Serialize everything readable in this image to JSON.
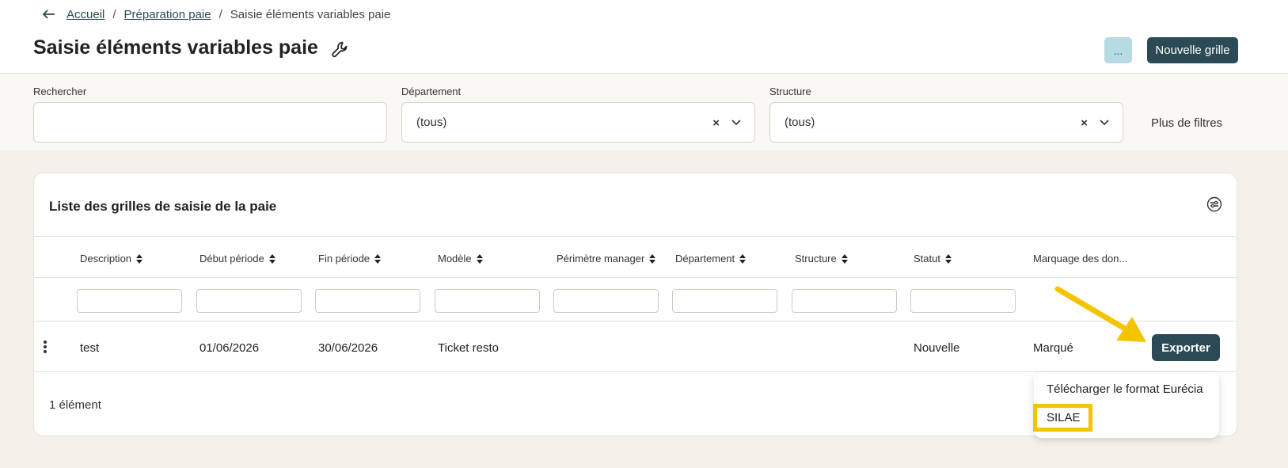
{
  "breadcrumb": {
    "home": "Accueil",
    "parent": "Préparation paie",
    "current": "Saisie éléments variables paie",
    "separator": "/"
  },
  "header": {
    "title": "Saisie éléments variables paie",
    "more_label": "...",
    "new_grid_label": "Nouvelle grille"
  },
  "filters": {
    "search": {
      "label": "Rechercher",
      "value": ""
    },
    "department": {
      "label": "Département",
      "value": "(tous)"
    },
    "structure": {
      "label": "Structure",
      "value": "(tous)"
    },
    "more_filters": "Plus de filtres"
  },
  "table": {
    "title": "Liste des grilles de saisie de la paie",
    "columns": [
      "Description",
      "Début période",
      "Fin période",
      "Modèle",
      "Périmètre manager",
      "Département",
      "Structure",
      "Statut",
      "Marquage des don..."
    ],
    "rows": [
      {
        "description": "test",
        "debut": "01/06/2026",
        "fin": "30/06/2026",
        "modele": "Ticket resto",
        "perimetre": "",
        "departement": "",
        "structure": "",
        "statut": "Nouvelle",
        "marquage": "Marqué"
      }
    ],
    "export_label": "Exporter",
    "count": "1 élément"
  },
  "export_menu": {
    "items": [
      "Télécharger le format Eurécia",
      "SILAE"
    ]
  },
  "colors": {
    "primary": "#2b4a55",
    "secondary_button": "#b7dbe4",
    "background": "#f5f1ea",
    "highlight": "#f5c400"
  }
}
